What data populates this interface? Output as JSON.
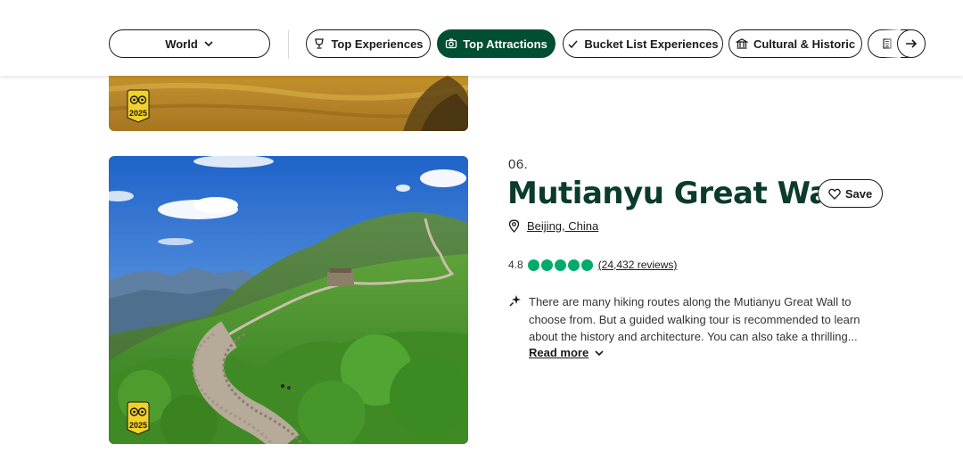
{
  "filters": {
    "world_label": "World",
    "items": [
      {
        "label": "Top Experiences",
        "icon": "trophy-icon",
        "active": false
      },
      {
        "label": "Top Attractions",
        "icon": "camera-icon",
        "active": true
      },
      {
        "label": "Bucket List Experiences",
        "icon": "check-icon",
        "active": false
      },
      {
        "label": "Cultural & Historic",
        "icon": "museum-icon",
        "active": false
      }
    ],
    "next_icon": "arrow-right-icon"
  },
  "colors": {
    "brand_green": "#004f32",
    "title_green": "#0a3b2c",
    "rating_green": "#00aa6c"
  },
  "badges": {
    "year": "2025"
  },
  "attraction": {
    "rank": "06.",
    "title": "Mutianyu Great Wall",
    "save_label": "Save",
    "location": "Beijing, China",
    "rating": "4.8",
    "rating_value": 4.8,
    "bubbles_filled": 5,
    "reviews": "(24,432 reviews)",
    "description": "There are many hiking routes along the Mutianyu Great Wall to choose from. But a guided walking tour is recommended to learn about the history and architecture. You can also take a thrilling...",
    "read_more": "Read more"
  }
}
